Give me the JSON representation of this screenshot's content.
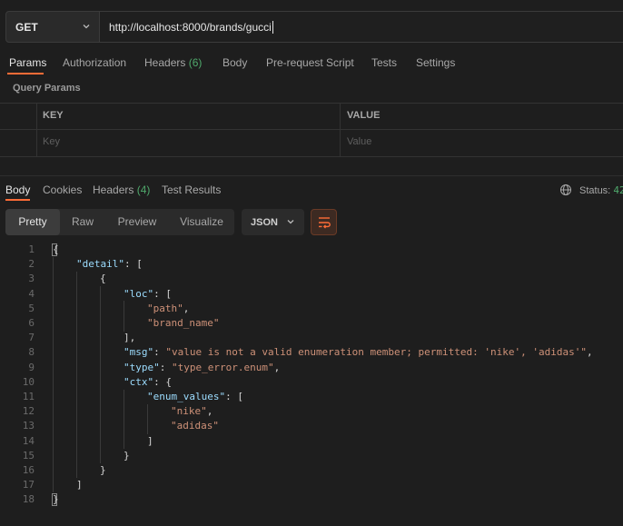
{
  "request": {
    "method": "GET",
    "url": "http://localhost:8000/brands/gucci"
  },
  "request_tabs": [
    {
      "label": "Params",
      "count": ""
    },
    {
      "label": "Authorization",
      "count": ""
    },
    {
      "label": "Headers",
      "count": "(6)"
    },
    {
      "label": "Body",
      "count": ""
    },
    {
      "label": "Pre-request Script",
      "count": ""
    },
    {
      "label": "Tests",
      "count": ""
    },
    {
      "label": "Settings",
      "count": ""
    }
  ],
  "query_params": {
    "title": "Query Params",
    "columns": [
      "KEY",
      "VALUE"
    ],
    "key_placeholder": "Key",
    "value_placeholder": "Value"
  },
  "response_tabs": [
    {
      "label": "Body",
      "count": ""
    },
    {
      "label": "Cookies",
      "count": ""
    },
    {
      "label": "Headers",
      "count": "(4)"
    },
    {
      "label": "Test Results",
      "count": ""
    }
  ],
  "status": {
    "label": "Status:",
    "code": "42"
  },
  "view_modes": [
    "Pretty",
    "Raw",
    "Preview",
    "Visualize"
  ],
  "format": "JSON",
  "body_lines": [
    [
      [
        "p",
        "{"
      ]
    ],
    [
      [
        "k",
        "\"detail\""
      ],
      [
        "p",
        ": ["
      ]
    ],
    [
      [
        "p",
        "{"
      ]
    ],
    [
      [
        "k",
        "\"loc\""
      ],
      [
        "p",
        ": ["
      ]
    ],
    [
      [
        "s",
        "\"path\""
      ],
      [
        "p",
        ","
      ]
    ],
    [
      [
        "s",
        "\"brand_name\""
      ]
    ],
    [
      [
        "p",
        "],"
      ]
    ],
    [
      [
        "k",
        "\"msg\""
      ],
      [
        "p",
        ": "
      ],
      [
        "s",
        "\"value is not a valid enumeration member; permitted: 'nike', 'adidas'\""
      ],
      [
        "p",
        ","
      ]
    ],
    [
      [
        "k",
        "\"type\""
      ],
      [
        "p",
        ": "
      ],
      [
        "s",
        "\"type_error.enum\""
      ],
      [
        "p",
        ","
      ]
    ],
    [
      [
        "k",
        "\"ctx\""
      ],
      [
        "p",
        ": {"
      ]
    ],
    [
      [
        "k",
        "\"enum_values\""
      ],
      [
        "p",
        ": ["
      ]
    ],
    [
      [
        "s",
        "\"nike\""
      ],
      [
        "p",
        ","
      ]
    ],
    [
      [
        "s",
        "\"adidas\""
      ]
    ],
    [
      [
        "p",
        "]"
      ]
    ],
    [
      [
        "p",
        "}"
      ]
    ],
    [
      [
        "p",
        "}"
      ]
    ],
    [
      [
        "p",
        "]"
      ]
    ],
    [
      [
        "p",
        "}"
      ]
    ]
  ],
  "icons": {
    "method_dropdown": "chevron-down-icon",
    "status": "globe-icon",
    "wrap": "wrap-lines-icon"
  },
  "colors": {
    "accent": "#ff6c37",
    "count": "#4fa86b",
    "json_key": "#9cdcfe",
    "json_string": "#ce9178"
  }
}
